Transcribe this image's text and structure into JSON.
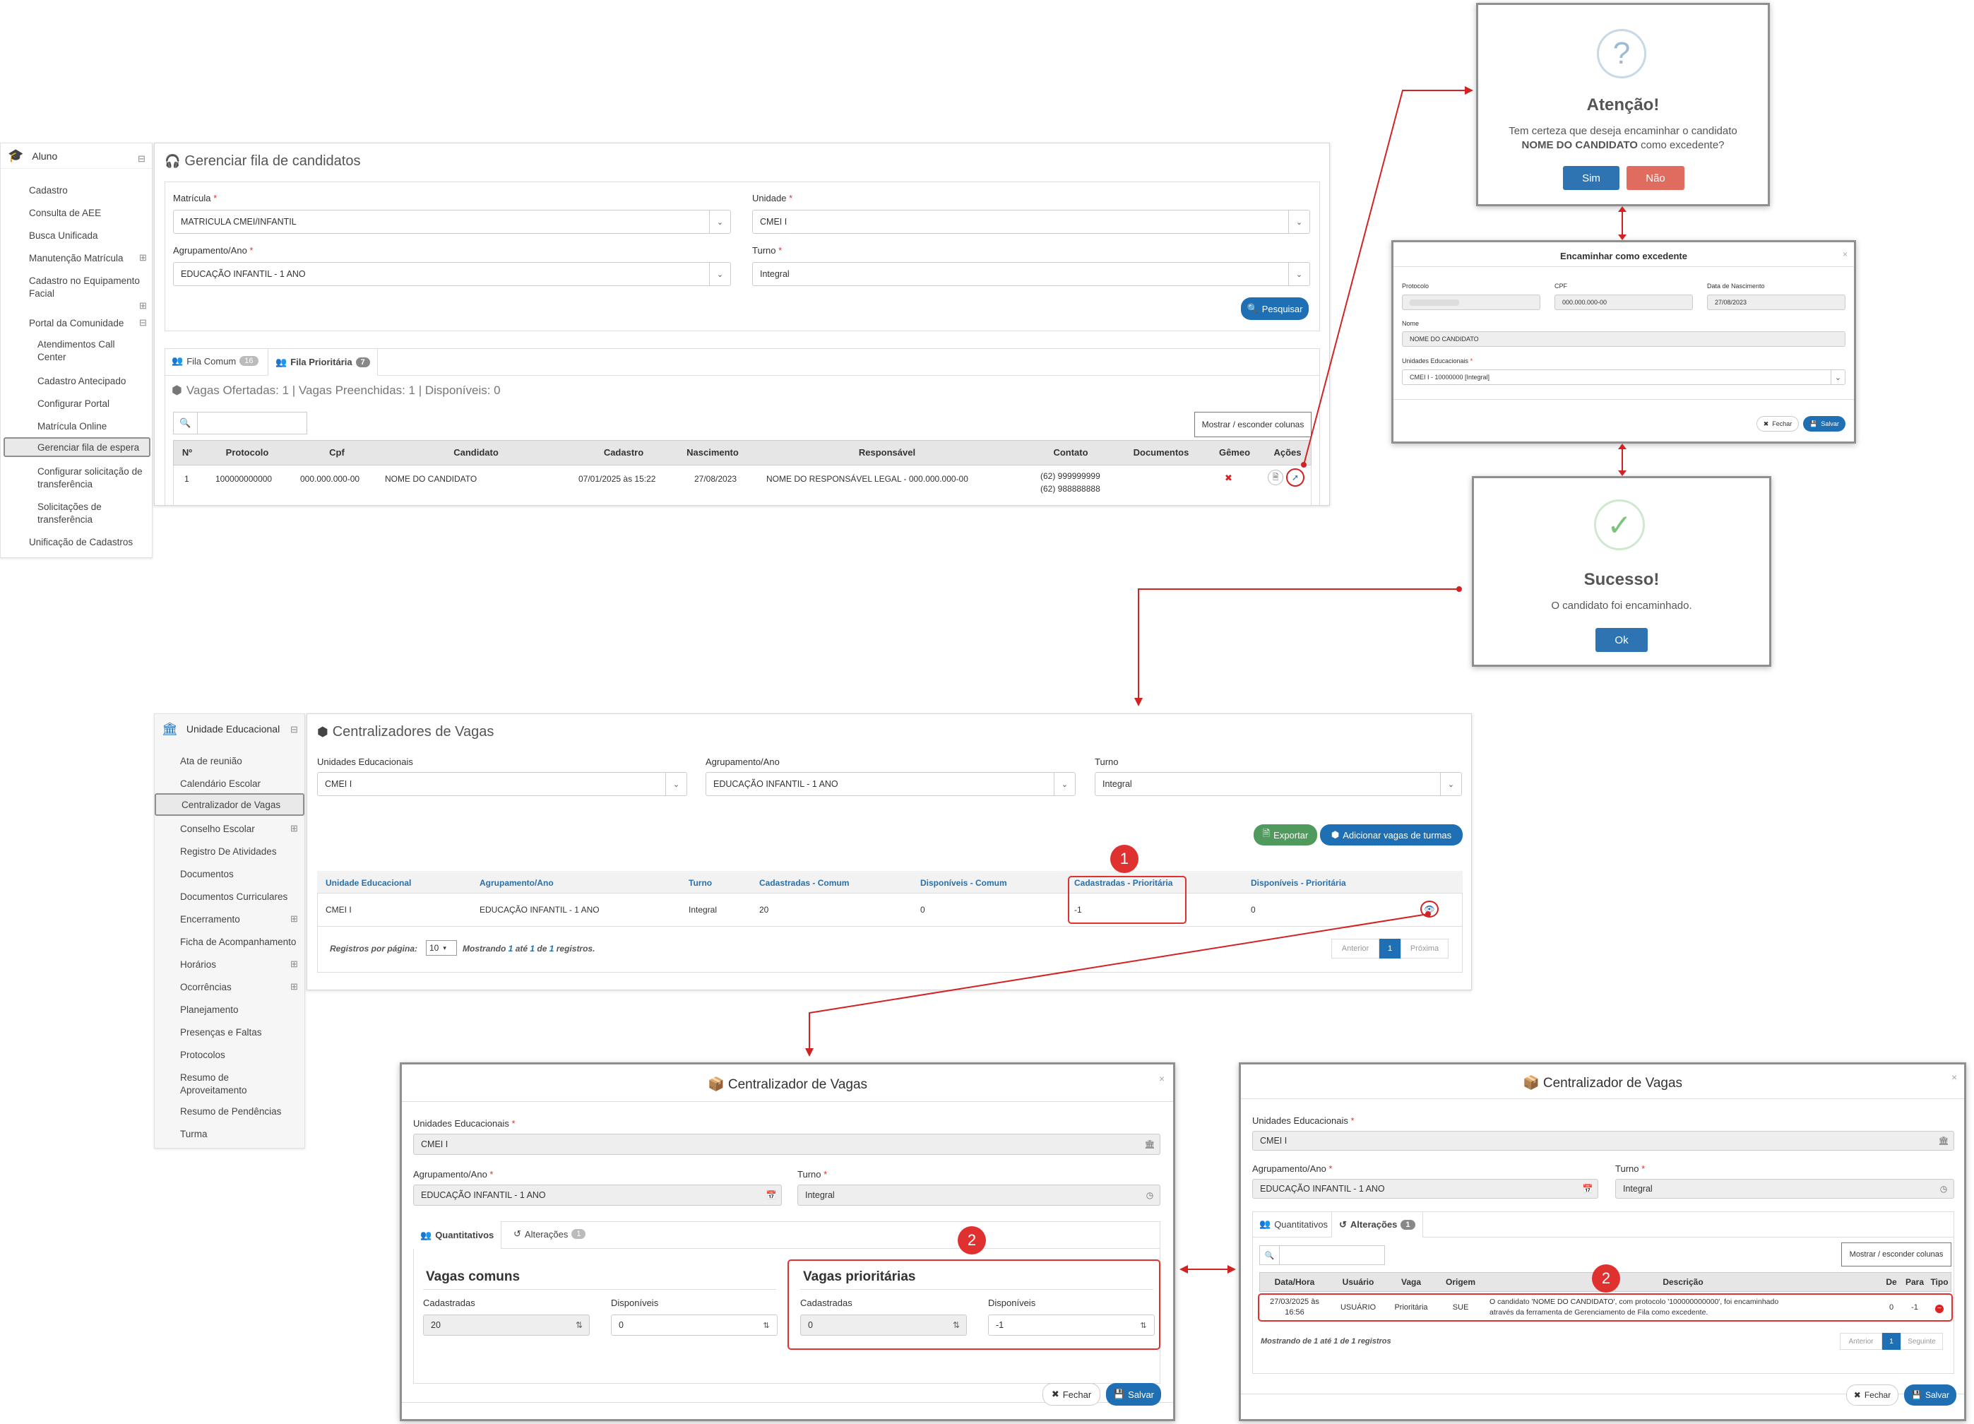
{
  "sidebar1": {
    "header": "Aluno",
    "items": [
      "Cadastro",
      "Consulta de AEE",
      "Busca Unificada",
      "Manutenção Matrícula",
      "Cadastro no Equipamento Facial",
      "Portal da Comunidade",
      "Atendimentos Call Center",
      "Cadastro Antecipado",
      "Configurar Portal",
      "Matrícula Online",
      "Gerenciar fila de espera",
      "Configurar solicitação de transferência",
      "Solicitações de transferência",
      "Unificação de Cadastros"
    ]
  },
  "fila": {
    "title": "Gerenciar fila de candidatos",
    "matricula_label": "Matrícula",
    "matricula_value": "MATRICULA CMEI/INFANTIL",
    "unidade_label": "Unidade",
    "unidade_value": "CMEI I",
    "agrupamento_label": "Agrupamento/Ano",
    "agrupamento_value": "EDUCAÇÃO INFANTIL - 1 ANO",
    "turno_label": "Turno",
    "turno_value": "Integral",
    "pesquisar": "Pesquisar",
    "tab_comum": "Fila Comum",
    "tab_comum_count": "16",
    "tab_prioritaria": "Fila Prioritária",
    "tab_prioritaria_count": "7",
    "vagas": "Vagas Ofertadas: 1 | Vagas Preenchidas: 1 | Disponíveis: 0",
    "mostrar": "Mostrar / esconder colunas",
    "headers": [
      "Nº",
      "Protocolo",
      "Cpf",
      "Candidato",
      "Cadastro",
      "Nascimento",
      "Responsável",
      "Contato",
      "Documentos",
      "Gêmeo",
      "Ações"
    ],
    "row": {
      "n": "1",
      "protocolo": "100000000000",
      "cpf": "000.000.000-00",
      "candidato": "NOME DO CANDIDATO",
      "cadastro": "07/01/2025 às 15:22",
      "nascimento": "27/08/2023",
      "responsavel": "NOME DO RESPONSÁVEL LEGAL - 000.000.000-00",
      "contato1": "(62) 999999999",
      "contato2": "(62) 988888888",
      "gemeo": "✖"
    }
  },
  "atencao": {
    "title": "Atenção!",
    "line1": "Tem certeza que deseja encaminhar o candidato",
    "line2_bold": "NOME DO CANDIDATO",
    "line2_rest": " como excedente?",
    "sim": "Sim",
    "nao": "Não"
  },
  "encaminhar": {
    "title": "Encaminhar como excedente",
    "protocolo_label": "Protocolo",
    "cpf_label": "CPF",
    "cpf_value": "000.000.000-00",
    "nasc_label": "Data de Nascimento",
    "nasc_value": "27/08/2023",
    "nome_label": "Nome",
    "nome_value": "NOME DO CANDIDATO",
    "unidades_label": "Unidades Educacionais",
    "unidades_value": "CMEI I - 10000000 [Integral]",
    "fechar": "Fechar",
    "salvar": "Salvar"
  },
  "sucesso": {
    "title": "Sucesso!",
    "msg": "O candidato foi encaminhado.",
    "ok": "Ok"
  },
  "sidebar2": {
    "header": "Unidade Educacional",
    "items": [
      "Ata de reunião",
      "Calendário Escolar",
      "Centralizador de Vagas",
      "Conselho Escolar",
      "Registro De Atividades",
      "Documentos",
      "Documentos Curriculares",
      "Encerramento",
      "Ficha de Acompanhamento",
      "Horários",
      "Ocorrências",
      "Planejamento",
      "Presenças e Faltas",
      "Protocolos",
      "Resumo de Aproveitamento",
      "Resumo de Pendências",
      "Turma"
    ]
  },
  "centr": {
    "title": "Centralizadores de Vagas",
    "unidades_label": "Unidades Educacionais",
    "unidades_value": "CMEI I",
    "agrup_label": "Agrupamento/Ano",
    "agrup_value": "EDUCAÇÃO INFANTIL - 1 ANO",
    "turno_label": "Turno",
    "turno_value": "Integral",
    "exportar": "Exportar",
    "adicionar": "Adicionar vagas de turmas",
    "headers": [
      "Unidade Educacional",
      "Agrupamento/Ano",
      "Turno",
      "Cadastradas - Comum",
      "Disponíveis - Comum",
      "Cadastradas - Prioritária",
      "Disponíveis - Prioritária"
    ],
    "row": [
      "CMEI I",
      "EDUCAÇÃO INFANTIL - 1 ANO",
      "Integral",
      "20",
      "0",
      "-1",
      "0"
    ],
    "reg_label": "Registros por página:",
    "reg_value": "10",
    "mostrando_a": "Mostrando ",
    "mostrando_b": "1",
    "mostrando_c": " até ",
    "mostrando_d": "1",
    "mostrando_e": " de ",
    "mostrando_f": "1",
    "mostrando_g": " registros.",
    "anterior": "Anterior",
    "page": "1",
    "proxima": "Próxima"
  },
  "modal1": {
    "title": "Centralizador de Vagas",
    "unidades_label": "Unidades Educacionais",
    "unidades_value": "CMEI I",
    "agrup_label": "Agrupamento/Ano",
    "agrup_value": "EDUCAÇÃO INFANTIL - 1 ANO",
    "turno_label": "Turno",
    "turno_value": "Integral",
    "tab_quant": "Quantitativos",
    "tab_alt": "Alterações",
    "tab_alt_count": "1",
    "comuns": "Vagas comuns",
    "prior": "Vagas prioritárias",
    "cad_label": "Cadastradas",
    "disp_label": "Disponíveis",
    "c_cad": "20",
    "c_disp": "0",
    "p_cad": "0",
    "p_disp": "-1",
    "fechar": "Fechar",
    "salvar": "Salvar"
  },
  "modal2": {
    "title": "Centralizador de Vagas",
    "unidades_label": "Unidades Educacionais",
    "unidades_value": "CMEI I",
    "agrup_label": "Agrupamento/Ano",
    "agrup_value": "EDUCAÇÃO INFANTIL - 1 ANO",
    "turno_label": "Turno",
    "turno_value": "Integral",
    "tab_quant": "Quantitativos",
    "tab_alt": "Alterações",
    "tab_alt_count": "1",
    "mostrar": "Mostrar / esconder colunas",
    "headers": [
      "Data/Hora",
      "Usuário",
      "Vaga",
      "Origem",
      "Descrição",
      "De",
      "Para",
      "Tipo"
    ],
    "row": {
      "data1": "27/03/2025 às",
      "data2": "16:56",
      "usuario": "USUÁRIO",
      "vaga": "Prioritária",
      "origem": "SUE",
      "desc1": "O candidato 'NOME DO CANDIDATO', com protocolo '100000000000', foi encaminhado",
      "desc2": "através da ferramenta de Gerenciamento de Fila como excedente.",
      "de": "0",
      "para": "-1"
    },
    "mostrando": "Mostrando de 1 até 1 de 1 registros",
    "anterior": "Anterior",
    "page": "1",
    "seguinte": "Seguinte",
    "fechar": "Fechar",
    "salvar": "Salvar"
  },
  "markers": {
    "one": "1",
    "two": "2"
  }
}
